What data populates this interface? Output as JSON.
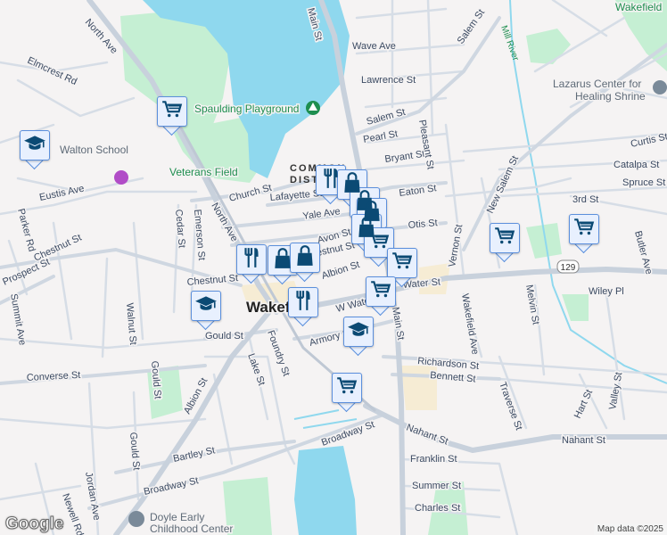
{
  "map": {
    "town": "Wakefield",
    "district": [
      "COMMON",
      "DISTRICT"
    ],
    "streets": {
      "main": "Main St",
      "north_ave": "North Ave",
      "wave": "Wave Ave",
      "lawrence": "Lawrence St",
      "salem": "Salem St",
      "pearl": "Pearl St",
      "bryant": "Bryant St",
      "church": "Church St",
      "lafayette": "Lafayette St",
      "eaton": "Eaton St",
      "yale": "Yale Ave",
      "otis": "Otis St",
      "avon": "Avon St",
      "chestnut": "Chestnut St",
      "albion": "Albion St",
      "water": "Water St",
      "w_water": "W Water St",
      "armory": "Armory St",
      "gould": "Gould St",
      "foundry": "Foundry St",
      "lake": "Lake St",
      "converse": "Converse St",
      "richardson": "Richardson St",
      "bennett": "Bennett St",
      "broadway": "Broadway St",
      "broadway2": "Broadway St",
      "nahant": "Nahant St",
      "nahant2": "Nahant St",
      "franklin": "Franklin St",
      "summer": "Summer St",
      "charles": "Charles St",
      "bartley": "Bartley St",
      "elmcrest": "Elmcrest Rd",
      "eustis": "Eustis Ave",
      "parker": "Parker Rd",
      "prospect": "Prospect St",
      "summit": "Summit Ave",
      "walnut": "Walnut St",
      "cedar": "Cedar St",
      "emerson": "Emerson St",
      "gould2": "Gould St",
      "jordan": "Jordan Ave",
      "newell": "Newell Rd",
      "pleasant": "Pleasant St",
      "vernon": "Vernon St",
      "wakefield_ave": "Wakefield Ave",
      "melvin": "Melvin St",
      "traverse": "Traverse St",
      "hart": "Hart St",
      "valley": "Valley St",
      "new_salem": "New Salem St",
      "curtis": "Curtis St",
      "catalpa": "Catalpa St",
      "spruce": "Spruce St",
      "third": "3rd St",
      "butler": "Butler Ave",
      "wiley": "Wiley Pl",
      "north_ave2": "North Ave",
      "albion2": "Albion St",
      "chestnut3": "Chestnut St"
    },
    "route_shield": "129",
    "river": "Mill River",
    "parks": {
      "veterans": "Veterans Field",
      "spaulding": "Spaulding Playground"
    },
    "pois": {
      "walton": "Walton School",
      "lazarus": [
        "Lazarus Center for",
        "Healing Shrine"
      ],
      "doyle": [
        "Doyle Early",
        "Childhood Center"
      ],
      "wakefield_ne": "Wakefield"
    },
    "markers": [
      {
        "type": "grocery"
      },
      {
        "type": "school"
      },
      {
        "type": "restaurant"
      },
      {
        "type": "shopping"
      },
      {
        "type": "shopping"
      },
      {
        "type": "restaurant"
      },
      {
        "type": "grocery"
      },
      {
        "type": "grocery"
      },
      {
        "type": "grocery"
      },
      {
        "type": "school"
      },
      {
        "type": "school"
      },
      {
        "type": "grocery"
      },
      {
        "type": "grocery"
      },
      {
        "type": "grocery"
      },
      {
        "type": "shopping"
      },
      {
        "type": "shopping"
      },
      {
        "type": "restaurant"
      }
    ],
    "colors": {
      "water": "#8fd8ee",
      "park": "#c5efd3",
      "marker_bg": "#e8f0fe",
      "marker_border": "#5b8fdc",
      "icon": "#0b4a74"
    }
  },
  "footer": {
    "logo": "Google",
    "attribution": "Map data ©2025"
  }
}
